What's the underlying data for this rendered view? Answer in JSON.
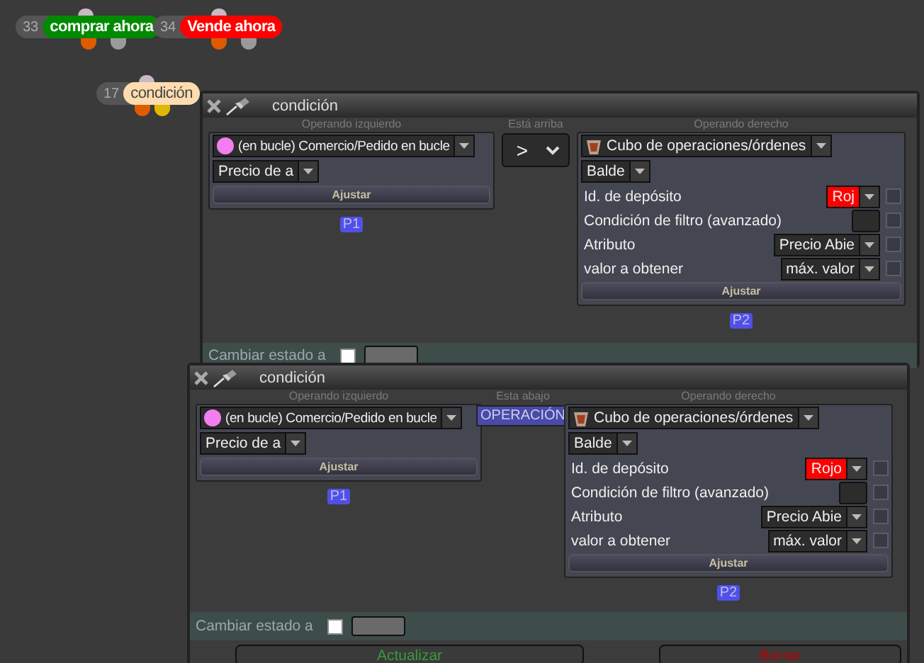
{
  "nodes": [
    {
      "number": "33",
      "label": "comprar ahora",
      "color": "#008a00",
      "outputs": [
        {
          "color": "#e05a00"
        },
        {
          "color": "#9a9a9a"
        }
      ]
    },
    {
      "number": "34",
      "label": "Vende ahora",
      "color": "#ff0000",
      "outputs": [
        {
          "color": "#e05a00"
        },
        {
          "color": "#9a9a9a"
        }
      ]
    },
    {
      "number": "17",
      "label": "condición",
      "color": "#ffdcb0",
      "outputs": [
        {
          "color": "#e05a00"
        },
        {
          "color": "#e0b800"
        }
      ]
    }
  ],
  "panels": [
    {
      "title": "condición",
      "left_operand": {
        "label": "Operando izquierdo",
        "source": "(en bucle) Comercio/Pedido en bucle",
        "field": "Precio de a",
        "button": "Ajustar",
        "tag": "P1"
      },
      "middle": {
        "label": "Está arriba",
        "kind": "select",
        "value": ">"
      },
      "right_operand": {
        "label": "Operando derecho",
        "source": "Cubo de operaciones/órdenes",
        "field": "Balde",
        "rows": [
          {
            "label": "Id. de depósito",
            "kind": "select",
            "value": "Roj",
            "color": "#ff0000",
            "checked": false
          },
          {
            "label": "Condición de filtro (avanzado)",
            "kind": "box",
            "checked": false
          },
          {
            "label": "Atributo",
            "kind": "select",
            "value": "Precio Abie",
            "checked": false
          },
          {
            "label": "valor a obtener",
            "kind": "select",
            "value": "máx. valor",
            "checked": false
          }
        ],
        "button": "Ajustar",
        "tag": "P2"
      },
      "state": {
        "label": "Cambiar estado a",
        "checked": false
      }
    },
    {
      "title": "condición",
      "left_operand": {
        "label": "Operando izquierdo",
        "source": "(en bucle) Comercio/Pedido en bucle",
        "field": "Precio de a",
        "button": "Ajustar",
        "tag": "P1"
      },
      "middle": {
        "label": "Esta abajo",
        "kind": "operation",
        "value": "OPERACIÓN"
      },
      "right_operand": {
        "label": "Operando derecho",
        "source": "Cubo de operaciones/órdenes",
        "field": "Balde",
        "rows": [
          {
            "label": "Id. de depósito",
            "kind": "select",
            "value": "Rojo",
            "color": "#ff0000",
            "checked": false
          },
          {
            "label": "Condición de filtro (avanzado)",
            "kind": "box",
            "checked": false
          },
          {
            "label": "Atributo",
            "kind": "select",
            "value": "Precio Abie",
            "checked": false
          },
          {
            "label": "valor a obtener",
            "kind": "select",
            "value": "máx. valor",
            "checked": false
          }
        ],
        "button": "Ajustar",
        "tag": "P2"
      },
      "state": {
        "label": "Cambiar estado a",
        "checked": false
      },
      "buttons": [
        {
          "label": "Actualizar",
          "kind": "update"
        },
        {
          "label": "Borrar",
          "kind": "delete"
        }
      ]
    }
  ]
}
